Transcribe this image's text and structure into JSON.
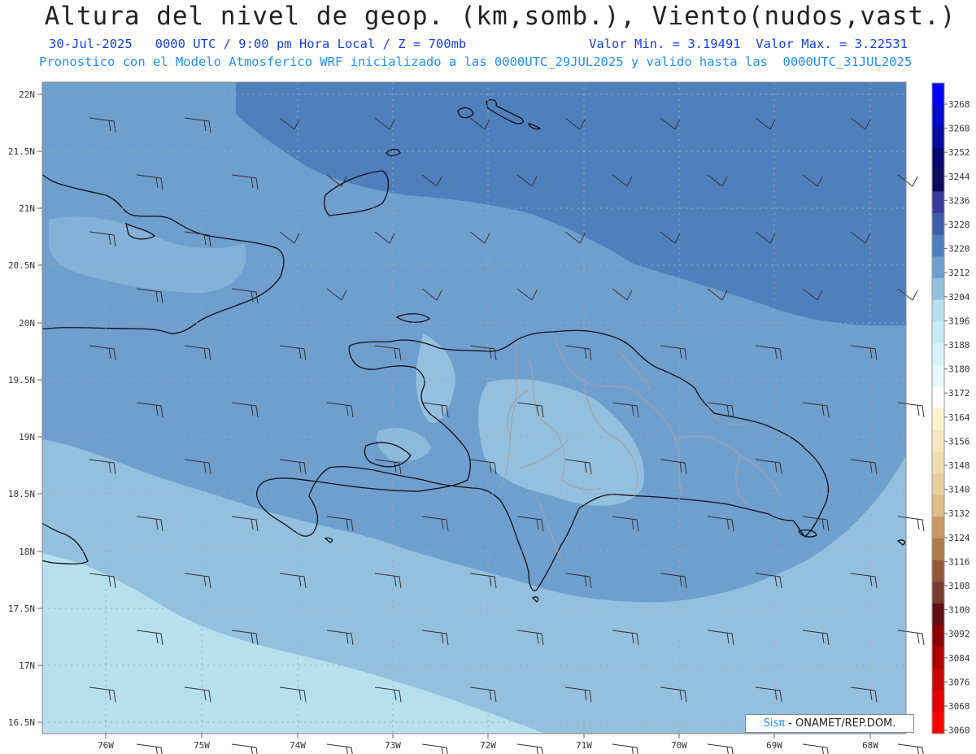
{
  "header": {
    "title": "Altura del nivel de geop. (km,somb.), Viento(nudos,vast.)",
    "date_line": "30-Jul-2025   0000 UTC / 9:00 pm Hora Local / Z = 700mb",
    "minmax_line": "Valor Min. = 3.19491  Valor Max. = 3.22531",
    "model_line": "Pronostico con el Modelo Atmosferico WRF inicializado a las 0000UTC_29JUL2025 y valido hasta las  0000UTC_31JUL2025"
  },
  "map": {
    "lat_labels": [
      "22N",
      "21.5N",
      "21N",
      "20.5N",
      "20N",
      "19.5N",
      "19N",
      "18.5N",
      "18N",
      "17.5N",
      "17N",
      "16.5N"
    ],
    "lon_labels": [
      "76W",
      "75W",
      "74W",
      "73W",
      "72W",
      "71W",
      "70W",
      "69W",
      "68W"
    ],
    "colors": {
      "fill_3220": "#4f7fbd",
      "fill_3212": "#6f9fce",
      "fill_3204": "#93c0df",
      "fill_3196": "#b7e0ef",
      "coast": "#111111",
      "provinces": "#9a9a9a",
      "grid": "#9aaab8"
    }
  },
  "colorbar": {
    "labels": [
      "3268",
      "3260",
      "3252",
      "3244",
      "3236",
      "3228",
      "3220",
      "3212",
      "3204",
      "3196",
      "3188",
      "3180",
      "3172",
      "3164",
      "3156",
      "3148",
      "3140",
      "3132",
      "3124",
      "3116",
      "3108",
      "3100",
      "3092",
      "3084",
      "3076",
      "3068",
      "3060"
    ],
    "colors": [
      "#0000ff",
      "#000bd0",
      "#0a0aa0",
      "#080870",
      "#0c0c5a",
      "#3a3a9e",
      "#3d5ea8",
      "#4f7fbd",
      "#6f9fce",
      "#93c0df",
      "#b7e0ef",
      "#c8ecf4",
      "#d8f2f7",
      "#e8f8fb",
      "#ffffff",
      "#fdf3cf",
      "#f6e8be",
      "#efddae",
      "#e8cfa0",
      "#dfbd88",
      "#c99862",
      "#b07a4a",
      "#96583a",
      "#7a3a2e",
      "#620f18",
      "#8c0000",
      "#b00000",
      "#cc0000",
      "#e20000",
      "#ff0000"
    ]
  },
  "credit": {
    "sis": "Sisπ",
    "org": "- ONAMET/REP.DOM."
  }
}
